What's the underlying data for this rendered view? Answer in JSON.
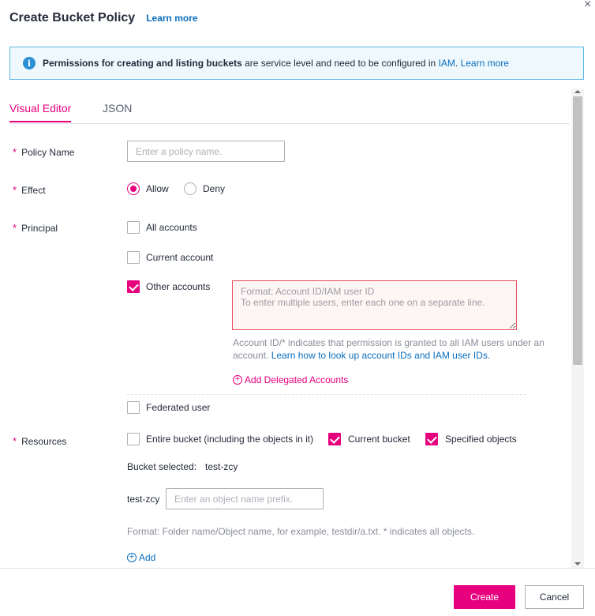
{
  "dialog": {
    "title": "Create Bucket Policy",
    "learn_more": "Learn more",
    "close_glyph": "×"
  },
  "notice": {
    "icon": "info-icon",
    "bold_text": "Permissions for creating and listing buckets",
    "text": " are service level and need to be configured in ",
    "iam_link": "IAM",
    "sep": ". ",
    "learn_more": "Learn more"
  },
  "tabs": [
    {
      "label": "Visual Editor",
      "active": true
    },
    {
      "label": "JSON",
      "active": false
    }
  ],
  "form": {
    "required_mark": "*",
    "policy_name": {
      "label": "Policy Name",
      "value": "",
      "placeholder": "Enter a policy name."
    },
    "effect": {
      "label": "Effect",
      "options": [
        {
          "label": "Allow",
          "selected": true
        },
        {
          "label": "Deny",
          "selected": false
        }
      ]
    },
    "principal": {
      "label": "Principal",
      "options": [
        {
          "label": "All accounts",
          "checked": false
        },
        {
          "label": "Current account",
          "checked": false
        },
        {
          "label": "Other accounts",
          "checked": true
        },
        {
          "label": "Federated user",
          "checked": false
        }
      ],
      "accounts_placeholder": "Format: Account ID/IAM user ID\nTo enter multiple users, enter each one on a separate line.",
      "hint_text": "Account ID/* indicates that permission is granted to all IAM users under an account. ",
      "hint_link": "Learn how to look up account IDs and IAM user IDs.",
      "add_delegated": "Add Delegated Accounts"
    },
    "resources": {
      "label": "Resources",
      "options": [
        {
          "label": "Entire bucket (including the objects in it)",
          "checked": false
        },
        {
          "label": "Current bucket",
          "checked": true
        },
        {
          "label": "Specified objects",
          "checked": true
        }
      ],
      "bucket_selected_label": "Bucket selected:",
      "bucket_selected_value": "test-zcy",
      "prefix_label": "test-zcy",
      "prefix_placeholder": "Enter an object name prefix.",
      "format_hint": "Format: Folder name/Object name, for example, testdir/a.txt. * indicates all objects.",
      "add": "Add"
    }
  },
  "footer": {
    "create": "Create",
    "cancel": "Cancel"
  },
  "colors": {
    "accent": "#e6007e",
    "link": "#0b6ebd",
    "notice_border": "#60b7e6",
    "notice_bg": "#eef8fd",
    "error_border": "#e6505a"
  }
}
